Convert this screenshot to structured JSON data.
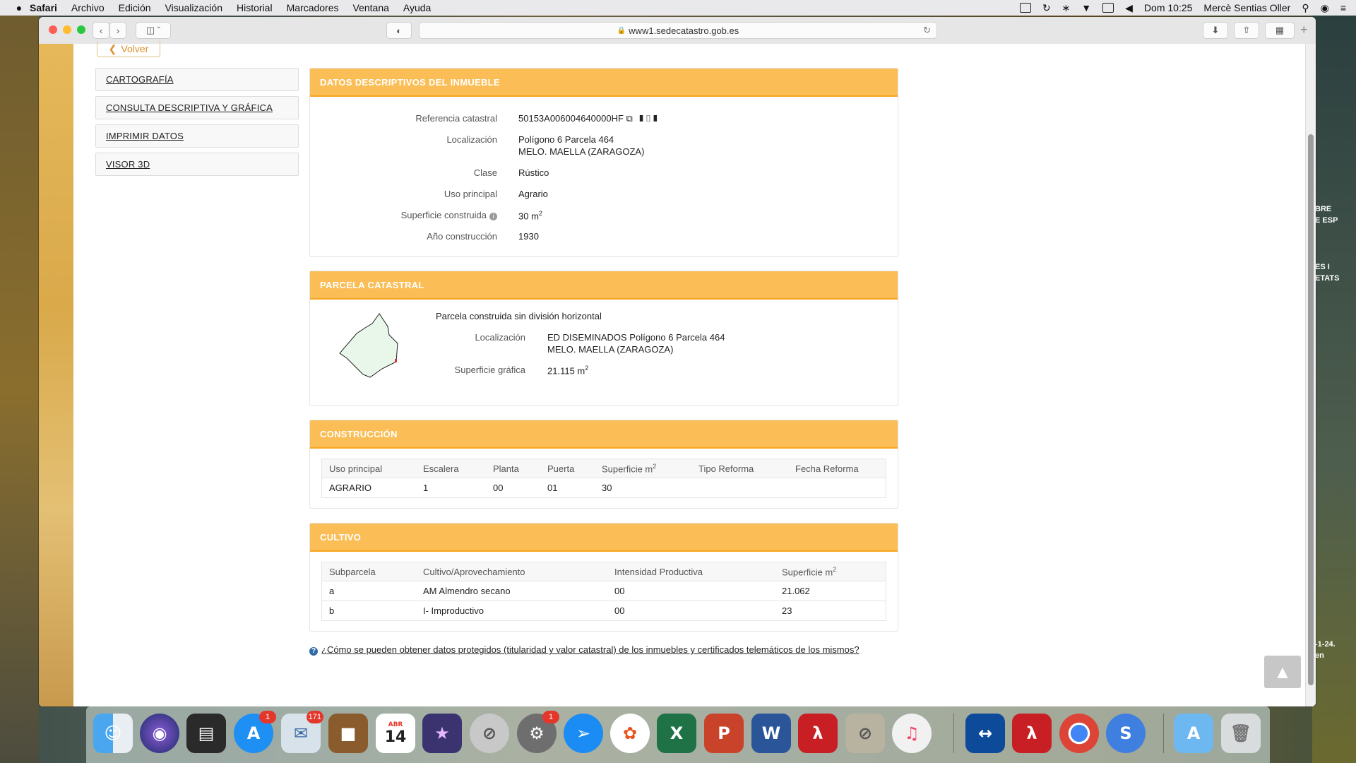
{
  "menubar": {
    "app": "Safari",
    "items": [
      "Archivo",
      "Edición",
      "Visualización",
      "Historial",
      "Marcadores",
      "Ventana",
      "Ayuda"
    ],
    "clock": "Dom 10:25",
    "user": "Mercè Sentias Oller"
  },
  "browser": {
    "url": "www1.sedecatastro.gob.es"
  },
  "page": {
    "back_label": "Volver",
    "sidenav": [
      "CARTOGRAFÍA",
      "CONSULTA DESCRIPTIVA Y GRÁFICA",
      "IMPRIMIR DATOS",
      "VISOR 3D"
    ],
    "datos": {
      "title": "DATOS DESCRIPTIVOS DEL INMUEBLE",
      "ref_label": "Referencia catastral",
      "ref_value": "50153A006004640000HF",
      "loc_label": "Localización",
      "loc_line1": "Polígono 6 Parcela 464",
      "loc_line2": "MELO. MAELLA (ZARAGOZA)",
      "clase_label": "Clase",
      "clase_value": "Rústico",
      "uso_label": "Uso principal",
      "uso_value": "Agrario",
      "sup_label": "Superficie construida",
      "sup_value": "30 m",
      "sup_sup": "2",
      "anio_label": "Año construcción",
      "anio_value": "1930"
    },
    "parcela": {
      "title": "PARCELA CATASTRAL",
      "subtitle": "Parcela construida sin división horizontal",
      "loc_label": "Localización",
      "loc_line1": "ED DISEMINADOS Polígono 6 Parcela 464",
      "loc_line2": "MELO. MAELLA (ZARAGOZA)",
      "sup_label": "Superficie gráfica",
      "sup_value": "21.115 m",
      "sup_sup": "2"
    },
    "construccion": {
      "title": "CONSTRUCCIÓN",
      "headers": [
        "Uso principal",
        "Escalera",
        "Planta",
        "Puerta",
        "Superficie m",
        "Tipo Reforma",
        "Fecha Reforma"
      ],
      "header_sup": "2",
      "rows": [
        [
          "AGRARIO",
          "1",
          "00",
          "01",
          "30",
          "",
          ""
        ]
      ]
    },
    "cultivo": {
      "title": "CULTIVO",
      "headers": [
        "Subparcela",
        "Cultivo/Aprovechamiento",
        "Intensidad Productiva",
        "Superficie m"
      ],
      "header_sup": "2",
      "rows": [
        [
          "a",
          "AM Almendro secano",
          "00",
          "21.062"
        ],
        [
          "b",
          "I- Improductivo",
          "00",
          "23"
        ]
      ]
    },
    "faq": "¿Cómo se pueden obtener datos protegidos (titularidad y valor catastral) de los inmuebles y certificados telemáticos de los mismos?"
  },
  "desktop": {
    "right_texts": [
      "BRE",
      "E ESP",
      "ES I",
      "ETATS",
      "-1-24.",
      "en"
    ]
  },
  "dock": {
    "calendar_month": "ABR",
    "calendar_day": "14",
    "badges": {
      "appstore": "1",
      "mail": "171",
      "prefs": "1"
    }
  }
}
